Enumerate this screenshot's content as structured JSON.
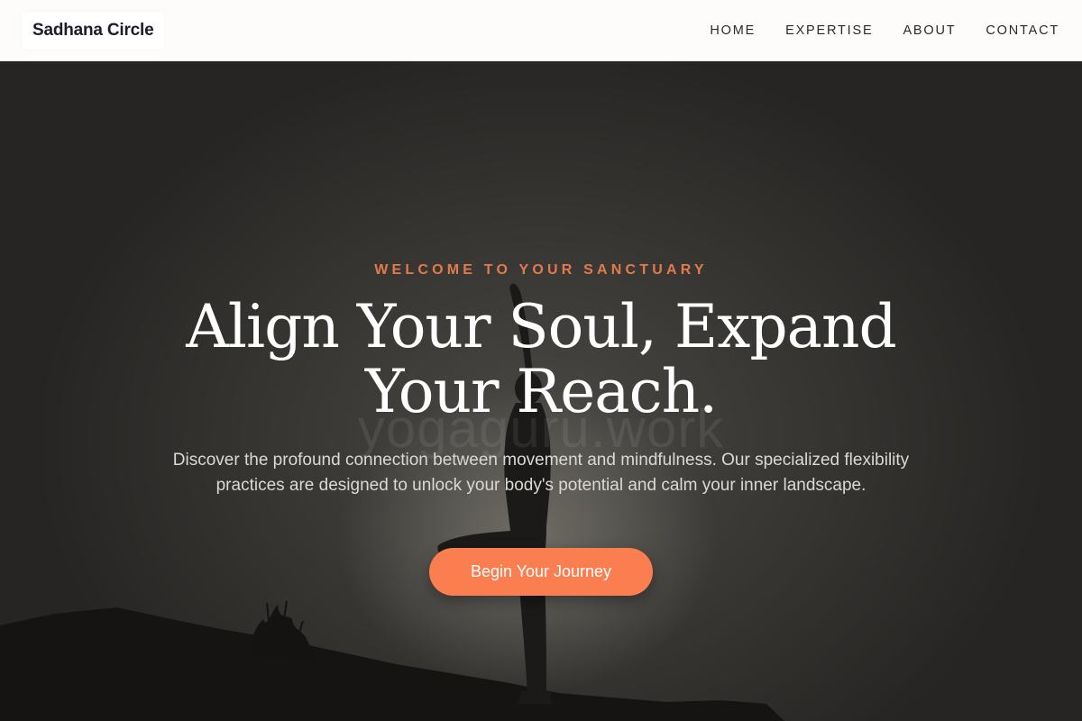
{
  "nav": {
    "brand": "Sadhana Circle",
    "items": [
      {
        "label": "HOME"
      },
      {
        "label": "EXPERTISE"
      },
      {
        "label": "ABOUT"
      },
      {
        "label": "CONTACT"
      }
    ]
  },
  "hero": {
    "eyebrow": "WELCOME TO YOUR SANCTUARY",
    "headline_line1": "Align Your Soul, Expand",
    "headline_line2": "Your Reach.",
    "description": "Discover the profound connection between movement and mindfulness. Our specialized flexibility practices are designed to unlock your body's potential and calm your inner landscape.",
    "cta_label": "Begin Your Journey",
    "watermark": "yogaguru.work"
  },
  "colors": {
    "accent": "#fb7e50",
    "eyebrow": "#e27a4d",
    "nav_bg": "#fdfcfa",
    "hero_bg": "#2a2927"
  }
}
